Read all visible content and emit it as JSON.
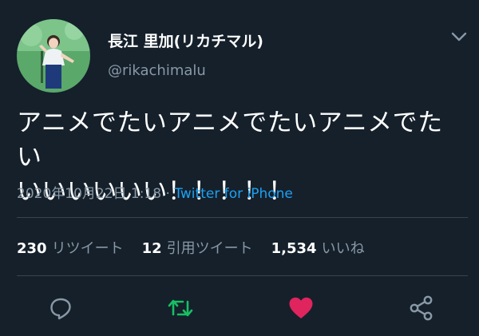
{
  "tweet": {
    "display_name": "長江 里加(リカチマル)",
    "handle": "@rikachimalu",
    "text_line1": "アニメでたいアニメでたいアニメでたい",
    "text_line2": "いいいいいい！！！！！",
    "timestamp": "2020年10月22日 1:18",
    "separator": " · ",
    "source": "Twitter for iPhone"
  },
  "stats": {
    "retweets_count": "230",
    "retweets_label": "リツイート",
    "quotes_count": "12",
    "quotes_label": "引用ツイート",
    "likes_count": "1,534",
    "likes_label": "いいね"
  },
  "icons": {
    "menu": "chevron-down-icon",
    "reply": "reply-icon",
    "retweet": "retweet-icon",
    "like": "heart-icon",
    "share": "share-icon"
  },
  "colors": {
    "background": "#15202b",
    "secondary_text": "#8899a6",
    "link": "#1da1f2",
    "retweet_active": "#17bf63",
    "like_active": "#e0245e"
  }
}
